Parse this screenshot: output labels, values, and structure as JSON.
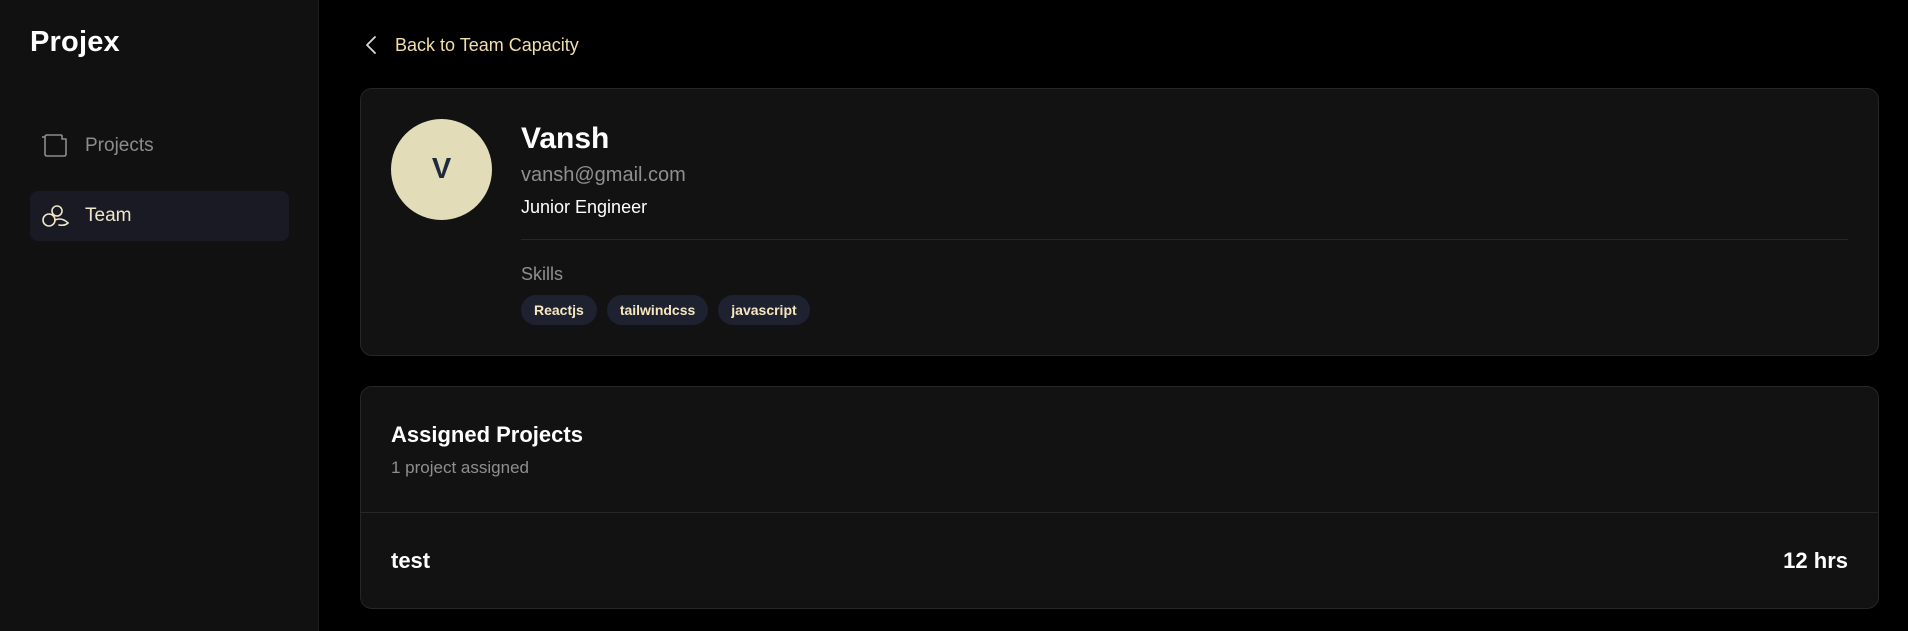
{
  "app": {
    "name": "Projex"
  },
  "sidebar": {
    "items": [
      {
        "label": "Projects",
        "icon": "folder-icon",
        "active": false
      },
      {
        "label": "Team",
        "icon": "team-icon",
        "active": true
      }
    ]
  },
  "nav": {
    "back_label": "Back to Team Capacity"
  },
  "profile": {
    "initial": "V",
    "name": "Vansh",
    "email": "vansh@gmail.com",
    "role": "Junior Engineer",
    "skills_label": "Skills",
    "skills": [
      "Reactjs",
      "tailwindcss",
      "javascript"
    ]
  },
  "assigned": {
    "title": "Assigned Projects",
    "count_text": "1 project assigned",
    "projects": [
      {
        "name": "test",
        "hours": "12 hrs"
      }
    ]
  },
  "colors": {
    "accent": "#f3dfae",
    "avatar_bg": "#e3dcb9",
    "card_bg": "#121212",
    "sidebar_bg": "#111111",
    "skill_bg": "#1e2230"
  }
}
